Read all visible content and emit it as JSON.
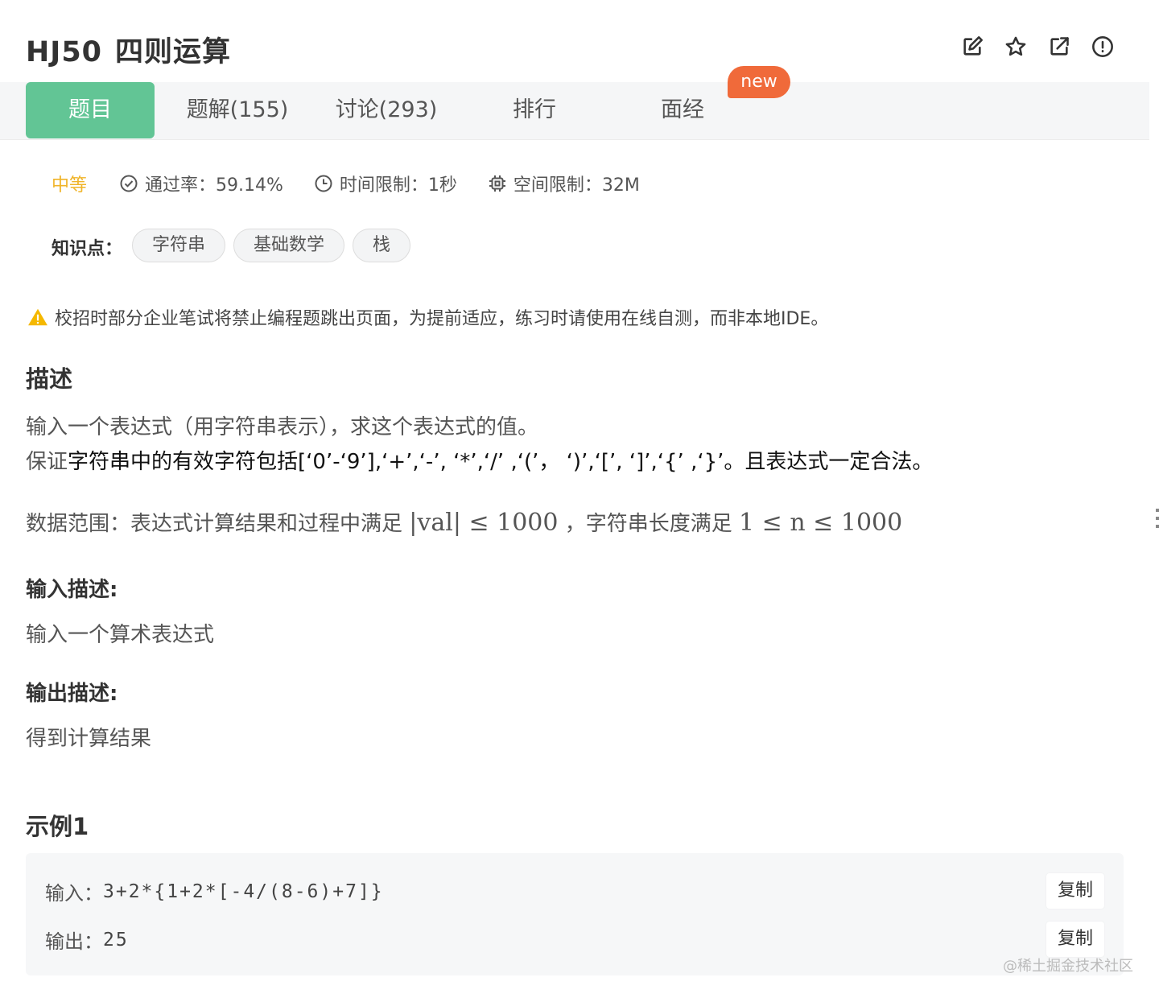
{
  "header": {
    "code": "HJ50",
    "title": "四则运算",
    "icons": [
      "edit-icon",
      "star-icon",
      "external-link-icon",
      "report-icon"
    ]
  },
  "tabs": [
    {
      "label": "题目",
      "active": true
    },
    {
      "label": "题解(155)",
      "active": false
    },
    {
      "label": "讨论(293)",
      "active": false
    },
    {
      "label": "排行",
      "active": false
    },
    {
      "label": "面经",
      "active": false
    }
  ],
  "new_badge": "new",
  "meta": {
    "level": "中等",
    "pass_rate": "通过率：59.14%",
    "time_limit": "时间限制：1秒",
    "space_limit": "空间限制：32M"
  },
  "knowledge": {
    "label": "知识点：",
    "tags": [
      "字符串",
      "基础数学",
      "栈"
    ]
  },
  "warning": "校招时部分企业笔试将禁止编程题跳出页面，为提前适应，练习时请使用在线自测，而非本地IDE。",
  "description": {
    "heading": "描述",
    "line1": "输入一个表达式（用字符串表示），求这个表达式的值。",
    "line2_prefix": "保证",
    "line2_rest": "字符串中的有效字符包括[‘0’-‘9’],‘+’,‘-’, ‘*’,‘/’ ,‘(’， ‘)’,‘[’, ‘]’,‘{’ ,‘}’。且表达式一定合法。",
    "range_prefix": "数据范围：表达式计算结果和过程中满足",
    "range_math1": "|val| ≤ 1000",
    "range_mid": "，字符串长度满足",
    "range_math2": "1 ≤ n ≤ 1000"
  },
  "input_desc": {
    "heading": "输入描述:",
    "text": "输入一个算术表达式"
  },
  "output_desc": {
    "heading": "输出描述:",
    "text": "得到计算结果"
  },
  "example": {
    "heading": "示例1",
    "input_label": "输入：",
    "input_value": "3+2*{1+2*[-4/(8-6)+7]}",
    "output_label": "输出：",
    "output_value": "25",
    "copy_label": "复制"
  },
  "watermark": "@稀土掘金技术社区",
  "colors": {
    "accent_green": "#62c595",
    "badge_orange": "#f06a3a",
    "level_yellow": "#f0b429",
    "warning_yellow": "#f5b800"
  }
}
